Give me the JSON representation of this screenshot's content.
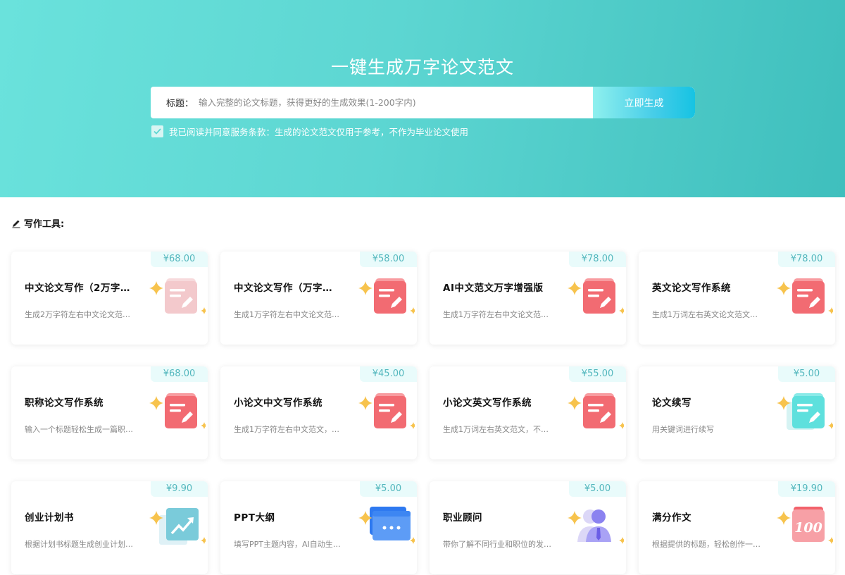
{
  "hero": {
    "title": "一键生成万字论文范文",
    "search_label": "标题：",
    "search_placeholder": "输入完整的论文标题，获得更好的生成效果(1-200字内)",
    "search_value": "",
    "generate_button": "立即生成",
    "agreement_text": "我已阅读并同意服务条款：生成的论文范文仅用于参考，不作为毕业论文使用",
    "agreement_checked": true
  },
  "tools": {
    "heading": "写作工具:",
    "items": [
      {
        "price": "¥68.00",
        "title": "中文论文写作（2万字…",
        "desc": "生成2万字符左右中文论文范…",
        "icon": "doc-pen-icon-faded"
      },
      {
        "price": "¥58.00",
        "title": "中文论文写作（万字…",
        "desc": "生成1万字符左右中文论文范…",
        "icon": "doc-pen-icon"
      },
      {
        "price": "¥78.00",
        "title": "AI中文范文万字增强版",
        "desc": "生成1万字符左右中文论文范…",
        "icon": "doc-pen-icon"
      },
      {
        "price": "¥78.00",
        "title": "英文论文写作系统",
        "desc": "生成1万词左右英文论文范文…",
        "icon": "doc-pen-icon"
      },
      {
        "price": "¥68.00",
        "title": "职称论文写作系统",
        "desc": "输入一个标题轻松生成一篇职…",
        "icon": "doc-pen-icon"
      },
      {
        "price": "¥45.00",
        "title": "小论文中文写作系统",
        "desc": "生成1万字符左右中文范文，…",
        "icon": "doc-pen-icon"
      },
      {
        "price": "¥55.00",
        "title": "小论文英文写作系统",
        "desc": "生成1万词左右英文范文，不…",
        "icon": "doc-pen-icon"
      },
      {
        "price": "¥5.00",
        "title": "论文续写",
        "desc": "用关键词进行续写",
        "icon": "doc-pen-icon-teal"
      },
      {
        "price": "¥9.90",
        "title": "创业计划书",
        "desc": "根据计划书标题生成创业计划…",
        "icon": "chart-up-icon"
      },
      {
        "price": "¥5.00",
        "title": "PPT大纲",
        "desc": "填写PPT主题内容，AI自动生…",
        "icon": "ppt-window-icon"
      },
      {
        "price": "¥5.00",
        "title": "职业顾问",
        "desc": "带你了解不同行业和职位的发…",
        "icon": "advisor-person-icon"
      },
      {
        "price": "¥19.90",
        "title": "满分作文",
        "desc": "根据提供的标题，轻松创作一…",
        "icon": "score-100-icon"
      }
    ]
  },
  "colors": {
    "hero_start": "#6ae2dc",
    "hero_end": "#3fbfbd",
    "price_text": "#53b7bd",
    "icon_red": "#f26b72",
    "sparkle": "#f7c34d"
  }
}
